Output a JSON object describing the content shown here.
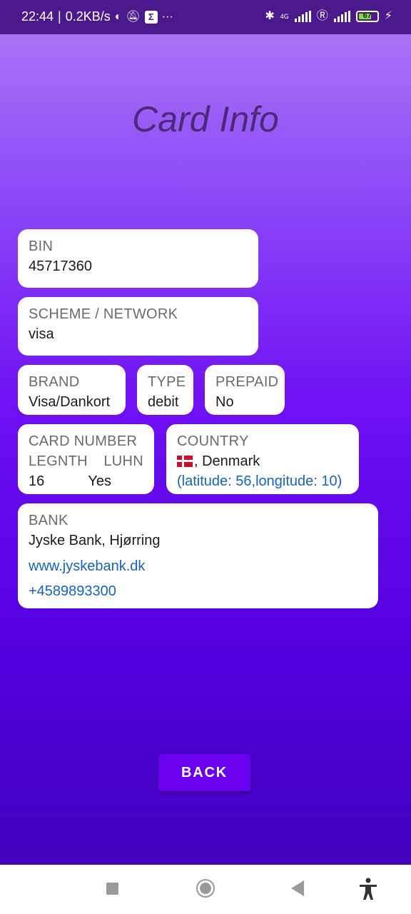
{
  "status_bar": {
    "time": "22:44",
    "speed": "0.2KB/s",
    "network_type": "4G",
    "battery_level": "67",
    "icons": [
      "data-saver-icon",
      "notifications-off-icon",
      "sigma-app-icon",
      "more-icon",
      "bluetooth-icon",
      "signal-icon",
      "roaming-icon",
      "signal-icon-2",
      "battery-icon",
      "charging-icon"
    ]
  },
  "page": {
    "title": "Card Info"
  },
  "bin": {
    "label": "BIN",
    "value": "45717360"
  },
  "scheme": {
    "label": "SCHEME / NETWORK",
    "value": "visa"
  },
  "brand": {
    "label": "BRAND",
    "value": "Visa/Dankort"
  },
  "type": {
    "label": "TYPE",
    "value": "debit"
  },
  "prepaid": {
    "label": "PREPAID",
    "value": "No"
  },
  "card_number": {
    "label": "CARD NUMBER",
    "length_label": "LEGNTH",
    "luhn_label": "LUHN",
    "length_value": "16",
    "luhn_value": "Yes"
  },
  "country": {
    "label": "COUNTRY",
    "value": ", Denmark",
    "flag": "denmark-flag",
    "coords": "(latitude: 56,longitude: 10)"
  },
  "bank": {
    "label": "BANK",
    "name": "Jyske Bank, Hjørring",
    "url": "www.jyskebank.dk",
    "phone": "+4589893300"
  },
  "back_button": {
    "label": "BACK"
  },
  "colors": {
    "accent": "#6a00f0",
    "link": "#1565c0",
    "title": "#4a2a7a"
  }
}
